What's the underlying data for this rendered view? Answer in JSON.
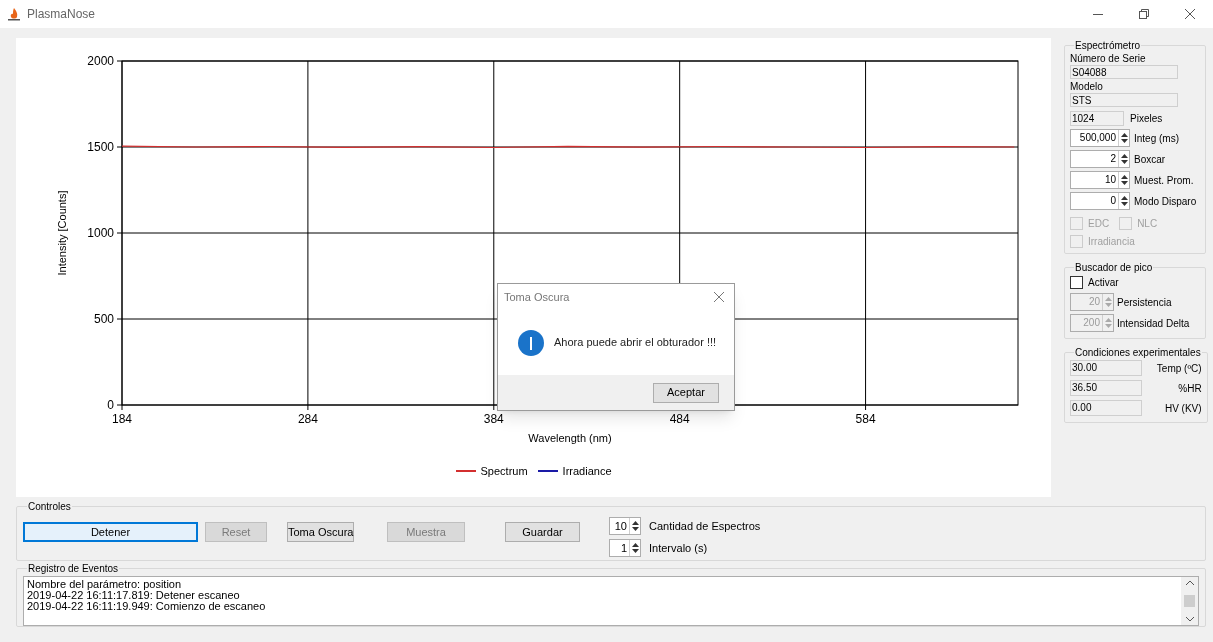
{
  "window": {
    "title": "PlasmaNose"
  },
  "chart": {
    "chart_data": {
      "type": "line",
      "grid": true,
      "xlabel": "Wavelength (nm)",
      "ylabel": "Intensity [Counts]",
      "x": [
        184,
        224,
        264,
        304,
        344,
        384,
        424,
        464,
        504,
        544,
        584,
        624,
        664
      ],
      "xlim": [
        184,
        666
      ],
      "ylim": [
        0,
        2000
      ],
      "xticks": [
        184,
        284,
        384,
        484,
        584
      ],
      "yticks": [
        0,
        500,
        1000,
        1500,
        2000
      ],
      "series": [
        {
          "name": "Spectrum",
          "color": "#d32f2f",
          "values": [
            1505,
            1500,
            1503,
            1498,
            1502,
            1497,
            1504,
            1499,
            1503,
            1500,
            1497,
            1502,
            1500
          ]
        },
        {
          "name": "Irradiance",
          "color": "#1a1aa6",
          "values": [
            null,
            null,
            null,
            null,
            null,
            null,
            null,
            null,
            null,
            null,
            null,
            null,
            null
          ]
        }
      ]
    }
  },
  "espectrometro": {
    "title": "Espectrómetro",
    "fields": [
      {
        "label": "Número de Serie",
        "value": "S04088"
      },
      {
        "label": "Modelo",
        "value": "STS"
      }
    ],
    "pixels": {
      "value": "1024",
      "label": "Pixeles"
    },
    "spinners": [
      {
        "value": "500,000",
        "label": "Integ (ms)"
      },
      {
        "value": "2",
        "label": "Boxcar"
      },
      {
        "value": "10",
        "label": "Muest. Prom."
      },
      {
        "value": "0",
        "label": "Modo Disparo"
      }
    ],
    "checkboxes": [
      {
        "label": "EDC",
        "checked": false,
        "disabled": true
      },
      {
        "label": "NLC",
        "checked": false,
        "disabled": true
      },
      {
        "label": "Irradiancia",
        "checked": false,
        "disabled": true
      }
    ]
  },
  "buscador": {
    "title": "Buscador de pico",
    "checkbox": {
      "label": "Activar",
      "checked": false,
      "disabled": false
    },
    "spinners": [
      {
        "value": "20",
        "label": "Persistencia",
        "disabled": true
      },
      {
        "value": "200",
        "label": "Intensidad Delta",
        "disabled": true
      }
    ]
  },
  "condiciones": {
    "title": "Condiciones experimentales",
    "readings": [
      {
        "value": "30.00",
        "label": "Temp (ºC)"
      },
      {
        "value": "36.50",
        "label": "%HR"
      },
      {
        "value": "0.00",
        "label": "HV (KV)"
      }
    ]
  },
  "controles": {
    "title": "Controles",
    "buttons": [
      {
        "label": "Detener",
        "disabled": false,
        "focused": true
      },
      {
        "label": "Reset",
        "disabled": true,
        "focused": false
      },
      {
        "label": "Toma Oscura",
        "disabled": false,
        "focused": false
      },
      {
        "label": "Muestra",
        "disabled": true,
        "focused": false
      },
      {
        "label": "Guardar",
        "disabled": false,
        "focused": false
      }
    ],
    "spinners": [
      {
        "value": "10",
        "label": "Cantidad de Espectros"
      },
      {
        "value": "1",
        "label": "Intervalo (s)"
      }
    ]
  },
  "registro": {
    "title": "Registro de Eventos",
    "lines": [
      "Nombre del parámetro: position",
      "2019-04-22 16:11:17.819: Detener escaneo",
      "2019-04-22 16:11:19.949: Comienzo de escaneo"
    ]
  },
  "dialog": {
    "title": "Toma Oscura",
    "message": "Ahora puede abrir el obturador !!!",
    "button": "Aceptar"
  }
}
